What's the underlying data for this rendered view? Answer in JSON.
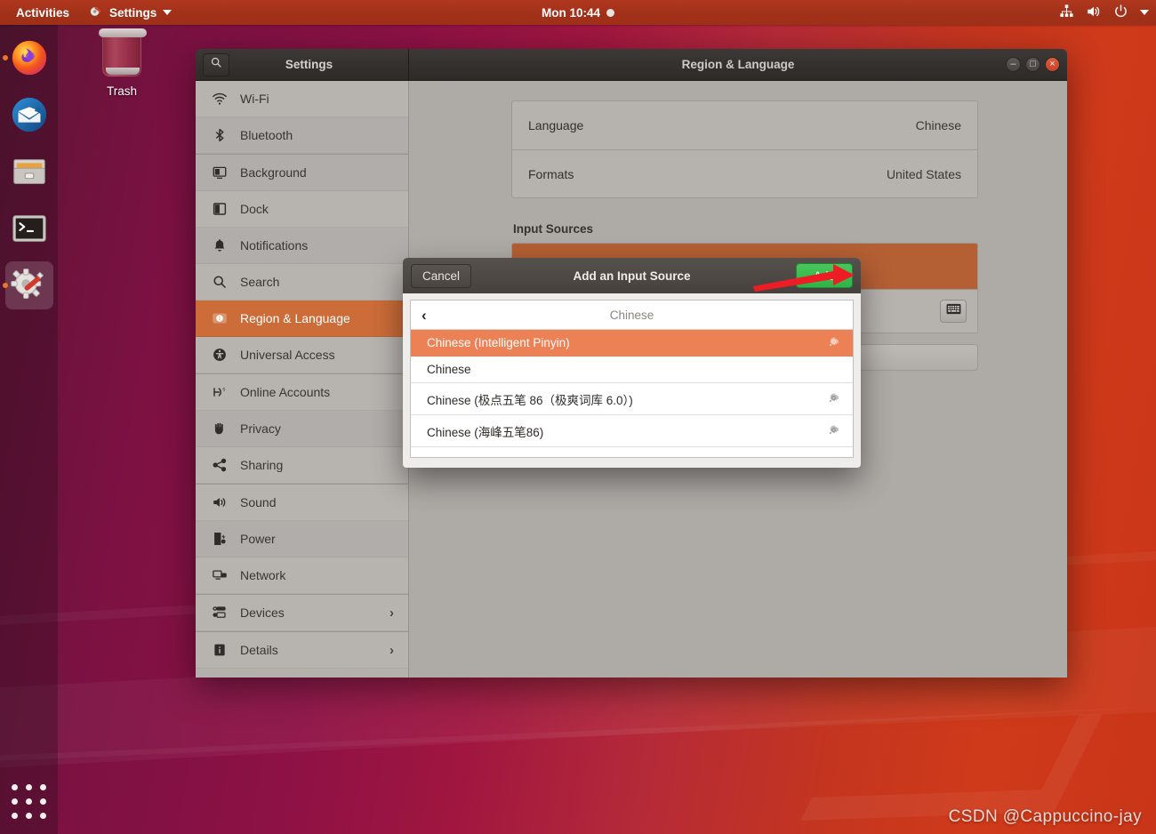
{
  "topbar": {
    "activities": "Activities",
    "app_menu": "Settings",
    "app_icon": "settings-gears-icon",
    "clock": "Mon 10:44",
    "notification_indicator": "notification-dot",
    "status_icons": [
      "network-icon",
      "volume-icon",
      "power-icon",
      "caret-down-icon"
    ]
  },
  "desktop": {
    "trash_label": "Trash",
    "trash_icon": "trash-can-icon",
    "watermark": "CSDN @Cappuccino-jay"
  },
  "dock": {
    "items": [
      {
        "name": "firefox",
        "icon": "firefox-icon",
        "running": true,
        "active": false
      },
      {
        "name": "thunderbird",
        "icon": "thunderbird-icon",
        "running": false,
        "active": false
      },
      {
        "name": "files",
        "icon": "files-cabinet-icon",
        "running": false,
        "active": false
      },
      {
        "name": "terminal",
        "icon": "terminal-icon",
        "running": false,
        "active": false
      },
      {
        "name": "settings",
        "icon": "settings-wrench-gear-icon",
        "running": true,
        "active": true
      }
    ],
    "show_applications": "apps-grid-icon"
  },
  "window": {
    "sidebar_title": "Settings",
    "search_icon": "search-icon",
    "main_title": "Region & Language",
    "controls": {
      "minimize": "–",
      "maximize": "□",
      "close": "×"
    }
  },
  "sidebar": {
    "items": [
      {
        "label": "Wi-Fi",
        "icon": "wifi-icon",
        "selected": false,
        "chevron": false,
        "sep_after": false
      },
      {
        "label": "Bluetooth",
        "icon": "bluetooth-icon",
        "selected": false,
        "chevron": false,
        "sep_after": true
      },
      {
        "label": "Background",
        "icon": "background-icon",
        "selected": false,
        "chevron": false,
        "sep_after": false
      },
      {
        "label": "Dock",
        "icon": "dock-icon",
        "selected": false,
        "chevron": false,
        "sep_after": false
      },
      {
        "label": "Notifications",
        "icon": "bell-icon",
        "selected": false,
        "chevron": false,
        "sep_after": false
      },
      {
        "label": "Search",
        "icon": "search-icon",
        "selected": false,
        "chevron": false,
        "sep_after": false
      },
      {
        "label": "Region & Language",
        "icon": "region-language-icon",
        "selected": true,
        "chevron": false,
        "sep_after": false
      },
      {
        "label": "Universal Access",
        "icon": "accessibility-icon",
        "selected": false,
        "chevron": false,
        "sep_after": true
      },
      {
        "label": "Online Accounts",
        "icon": "online-accounts-icon",
        "selected": false,
        "chevron": false,
        "sep_after": false
      },
      {
        "label": "Privacy",
        "icon": "privacy-hand-icon",
        "selected": false,
        "chevron": false,
        "sep_after": false
      },
      {
        "label": "Sharing",
        "icon": "sharing-icon",
        "selected": false,
        "chevron": false,
        "sep_after": true
      },
      {
        "label": "Sound",
        "icon": "sound-speaker-icon",
        "selected": false,
        "chevron": false,
        "sep_after": false
      },
      {
        "label": "Power",
        "icon": "power-battery-icon",
        "selected": false,
        "chevron": false,
        "sep_after": false
      },
      {
        "label": "Network",
        "icon": "network-icon",
        "selected": false,
        "chevron": false,
        "sep_after": true
      },
      {
        "label": "Devices",
        "icon": "devices-icon",
        "selected": false,
        "chevron": true,
        "sep_after": true
      },
      {
        "label": "Details",
        "icon": "details-info-icon",
        "selected": false,
        "chevron": true,
        "sep_after": false
      }
    ],
    "chevron_glyph": "›"
  },
  "content": {
    "rows": [
      {
        "label": "Language",
        "value": "Chinese"
      },
      {
        "label": "Formats",
        "value": "United States"
      }
    ],
    "input_sources_title": "Input Sources",
    "keyboard_button_icon": "keyboard-icon"
  },
  "dialog": {
    "cancel_label": "Cancel",
    "title": "Add an Input Source",
    "add_label": "Add",
    "back_icon": "chevron-left-icon",
    "back_glyph": "‹",
    "language_header": "Chinese",
    "gear_icon": "gear-icon",
    "items": [
      {
        "label": "Chinese (Intelligent Pinyin)",
        "selected": true,
        "has_gear": true,
        "tall": false
      },
      {
        "label": "Chinese",
        "selected": false,
        "has_gear": false,
        "tall": false
      },
      {
        "label": "Chinese (极点五笔 86（极爽词库 6.0）)",
        "selected": false,
        "has_gear": true,
        "tall": true
      },
      {
        "label": "Chinese (海峰五笔86)",
        "selected": false,
        "has_gear": true,
        "tall": true
      }
    ]
  },
  "annotation": {
    "arrow": "red-arrow-pointing-to-add-button",
    "color": "#ee1c25"
  },
  "colors": {
    "accent_orange": "#cb6c39",
    "selection_orange": "#ed8156",
    "add_button_green": "#2fb347",
    "topbar_red": "#a33119",
    "window_chrome": "#46413d",
    "panel_gray": "#b6b2ae"
  }
}
